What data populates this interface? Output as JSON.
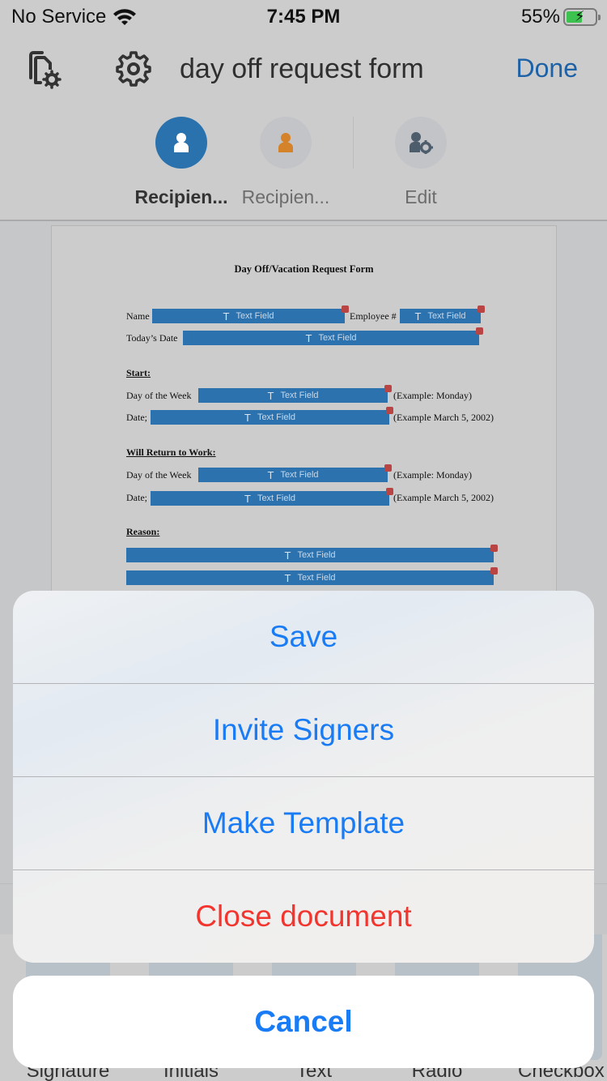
{
  "status_bar": {
    "carrier": "No Service",
    "time": "7:45 PM",
    "battery_percent": "55%",
    "battery_level": 0.55,
    "charging": true
  },
  "nav": {
    "title": "day off request form",
    "done_label": "Done",
    "left_icons": [
      "document-settings-icon",
      "gear-icon"
    ]
  },
  "roles": [
    {
      "label": "Recipien...",
      "icon": "person-icon",
      "color": "#2a72ae",
      "active": true
    },
    {
      "label": "Recipien...",
      "icon": "person-icon",
      "color": "#d4832a",
      "active": false
    },
    {
      "label": "Edit",
      "icon": "person-gear-icon",
      "color": "#4e5d6c",
      "active": false
    }
  ],
  "document": {
    "title": "Day Off/Vacation Request Form",
    "field_placeholder": "Text Field",
    "labels": {
      "name": "Name",
      "employee": "Employee #",
      "todays_date": "Today’s Date",
      "start": "Start:",
      "day_of_week": "Day of the Week",
      "date": "Date;",
      "example_day": "(Example: Monday)",
      "example_date": "(Example March 5, 2002)",
      "will_return": "Will Return to Work:",
      "reason": "Reason:"
    }
  },
  "toolbar": {
    "tools": [
      "Signature",
      "Initials",
      "Text",
      "Radio",
      "Checkbox"
    ]
  },
  "action_sheet": {
    "items": [
      {
        "label": "Save",
        "destructive": false
      },
      {
        "label": "Invite Signers",
        "destructive": false
      },
      {
        "label": "Make Template",
        "destructive": false
      },
      {
        "label": "Close document",
        "destructive": true
      }
    ],
    "cancel_label": "Cancel"
  },
  "colors": {
    "accent": "#1a7cf5",
    "destructive": "#f2352e",
    "field": "#2b72ae"
  }
}
